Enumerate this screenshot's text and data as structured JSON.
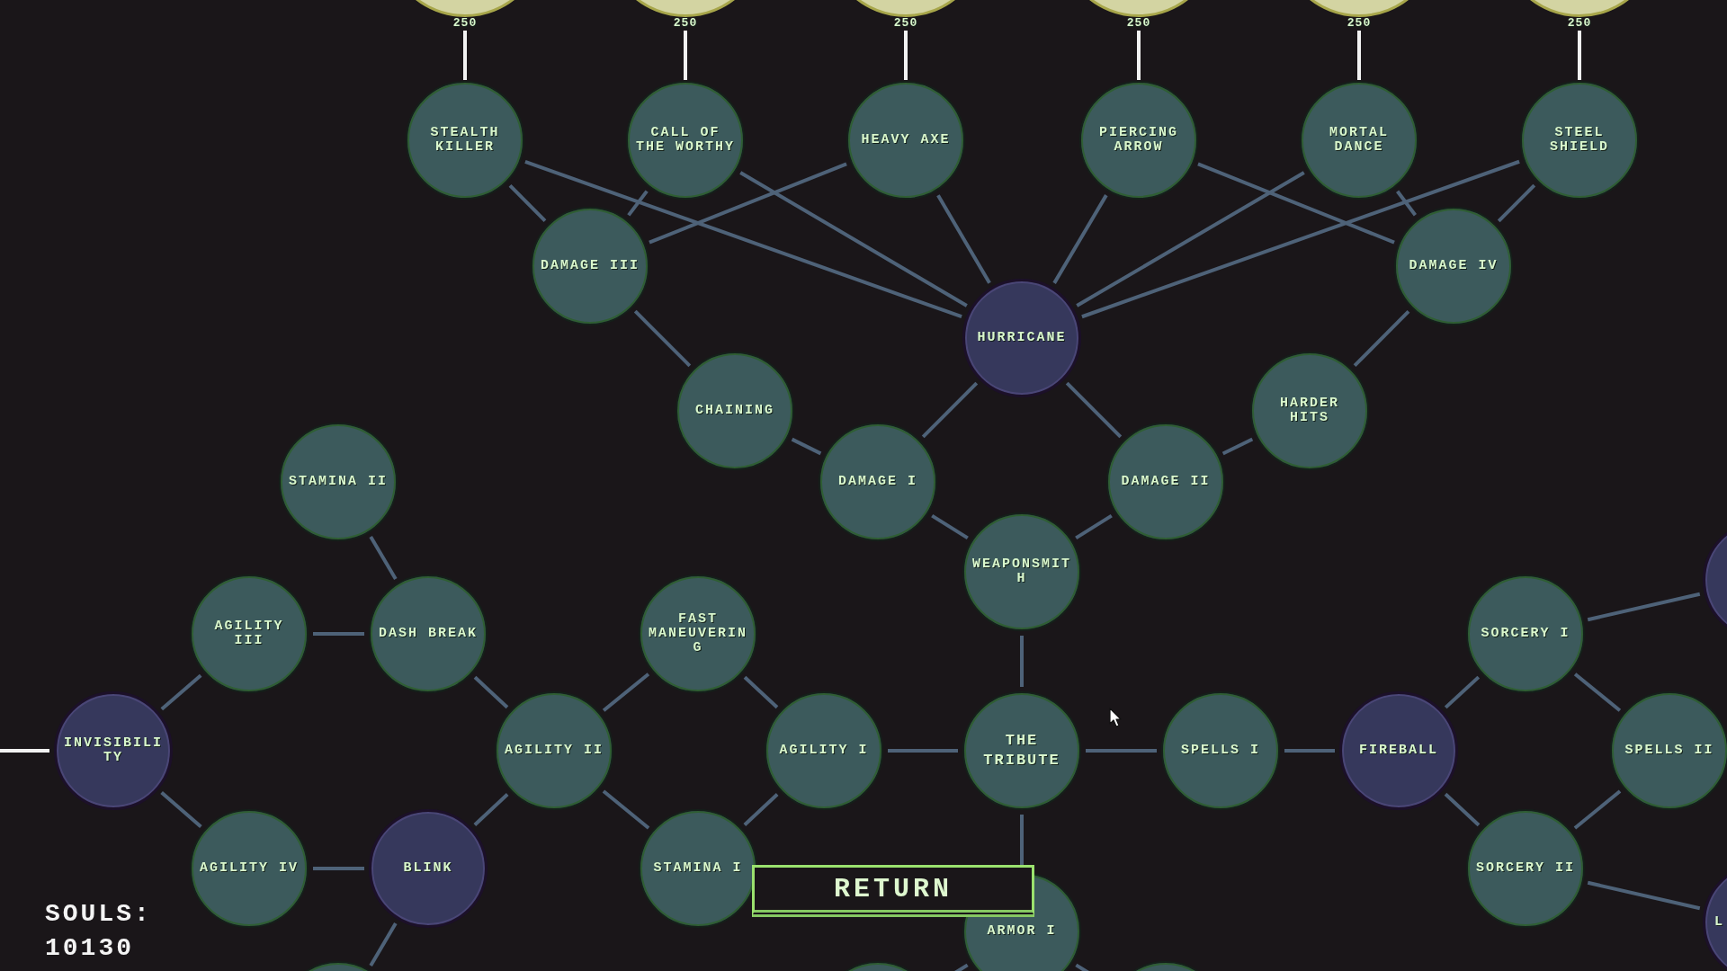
{
  "skill_tree": {
    "nodes": [
      {
        "label": "STEALTH KILLER",
        "kind": "upgrade",
        "cost": "250"
      },
      {
        "label": "CALL OF THE WORTHY",
        "kind": "upgrade",
        "cost": "250"
      },
      {
        "label": "HEAVY AXE",
        "kind": "upgrade",
        "cost": "250"
      },
      {
        "label": "PIERCING ARROW",
        "kind": "upgrade",
        "cost": "250"
      },
      {
        "label": "MORTAL DANCE",
        "kind": "upgrade",
        "cost": "250"
      },
      {
        "label": "STEEL SHIELD",
        "kind": "upgrade",
        "cost": "250"
      },
      {
        "label": "DAMAGE III",
        "kind": "upgrade"
      },
      {
        "label": "DAMAGE IV",
        "kind": "upgrade"
      },
      {
        "label": "HURRICANE",
        "kind": "ability"
      },
      {
        "label": "CHAINING",
        "kind": "upgrade"
      },
      {
        "label": "HARDER HITS",
        "kind": "upgrade"
      },
      {
        "label": "STAMINA II",
        "kind": "upgrade"
      },
      {
        "label": "DAMAGE I",
        "kind": "upgrade"
      },
      {
        "label": "DAMAGE II",
        "kind": "upgrade"
      },
      {
        "label": "WEAPONSMITH",
        "kind": "upgrade"
      },
      {
        "kind": "ability"
      },
      {
        "label": "AGILITY III",
        "kind": "upgrade"
      },
      {
        "label": "DASH BREAK",
        "kind": "upgrade"
      },
      {
        "label": "FAST MANEUVERING",
        "kind": "upgrade"
      },
      {
        "label": "SORCERY I",
        "kind": "upgrade"
      },
      {
        "label": "INVISIBILITY",
        "kind": "ability"
      },
      {
        "label": "AGILITY II",
        "kind": "upgrade"
      },
      {
        "label": "AGILITY I",
        "kind": "upgrade"
      },
      {
        "label": "THE TRIBUTE",
        "kind": "root"
      },
      {
        "label": "SPELLS I",
        "kind": "upgrade"
      },
      {
        "label": "FIREBALL",
        "kind": "ability"
      },
      {
        "label": "SPELLS II",
        "kind": "upgrade"
      },
      {
        "label": "AGILITY IV",
        "kind": "upgrade"
      },
      {
        "label": "BLINK",
        "kind": "ability"
      },
      {
        "label": "STAMINA I",
        "kind": "upgrade"
      },
      {
        "label": "SORCERY II",
        "kind": "upgrade"
      },
      {
        "label": "L",
        "kind": "ability"
      },
      {
        "label": "ARMOR I",
        "kind": "upgrade"
      },
      {
        "kind": "upgrade"
      },
      {
        "kind": "upgrade"
      },
      {
        "kind": "upgrade"
      }
    ]
  },
  "return_button": {
    "label": "RETURN"
  },
  "souls": {
    "label": "SOULS:",
    "value": "10130"
  }
}
